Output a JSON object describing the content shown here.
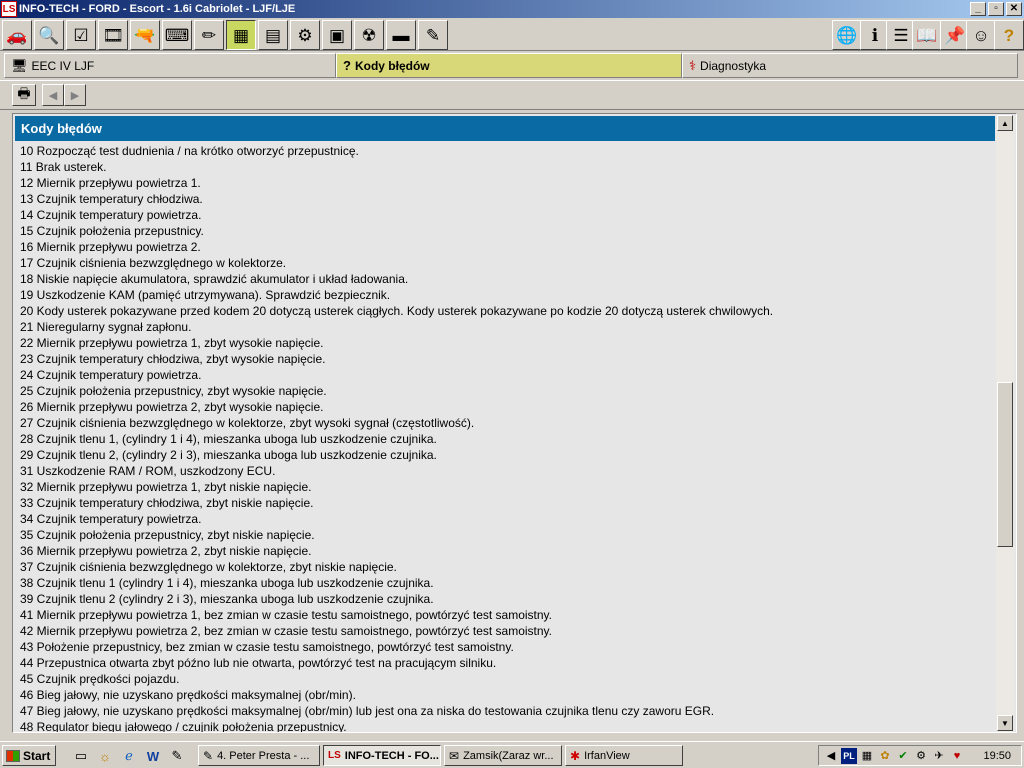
{
  "window": {
    "title": "INFO-TECH - FORD - Escort - 1.6i Cabriolet - LJF/LJE",
    "app_icon": "LS",
    "caption_buttons": {
      "minimize": "_",
      "maximize": "▫",
      "close": "✕"
    }
  },
  "toolbar": {
    "left": [
      {
        "name": "car-icon",
        "glyph": "🚗"
      },
      {
        "name": "search-info-icon",
        "glyph": "🔍"
      },
      {
        "name": "checkbox-icon",
        "glyph": "☑"
      },
      {
        "name": "film-icon",
        "glyph": "🎞"
      },
      {
        "name": "gun-icon",
        "glyph": "🔫"
      },
      {
        "name": "keyboard-icon",
        "glyph": "⌨"
      },
      {
        "name": "pencil-icon",
        "glyph": "✏"
      },
      {
        "name": "circuit-icon",
        "glyph": "▦"
      },
      {
        "name": "component-icon",
        "glyph": "▤"
      },
      {
        "name": "motor-icon",
        "glyph": "⚙"
      },
      {
        "name": "diagram-icon",
        "glyph": "▣"
      },
      {
        "name": "gauge-icon",
        "glyph": "☢"
      },
      {
        "name": "battery-icon",
        "glyph": "▬"
      },
      {
        "name": "probe-icon",
        "glyph": "✎"
      }
    ],
    "right": [
      {
        "name": "globe-icon",
        "glyph": "🌐"
      },
      {
        "name": "info-icon",
        "glyph": "ℹ"
      },
      {
        "name": "list-icon",
        "glyph": "☰"
      },
      {
        "name": "book-icon",
        "glyph": "📖"
      },
      {
        "name": "pin-icon",
        "glyph": "📌"
      },
      {
        "name": "person-icon",
        "glyph": "☺"
      },
      {
        "name": "help-icon",
        "glyph": "?"
      }
    ]
  },
  "tabs": [
    {
      "label": "EEC IV LJF",
      "icon": "🖥"
    },
    {
      "label": "Kody błędów",
      "icon": "?"
    },
    {
      "label": "Diagnostyka",
      "icon": "⚕"
    }
  ],
  "nav": {
    "print_icon": "🖶",
    "back_icon": "◀",
    "forward_icon": "▶"
  },
  "content": {
    "header": "Kody błędów",
    "rows": [
      "10 Rozpocząć test dudnienia / na krótko otworzyć przepustnicę.",
      "11 Brak usterek.",
      "12 Miernik przepływu powietrza 1.",
      "13 Czujnik temperatury chłodziwa.",
      "14 Czujnik temperatury powietrza.",
      "15 Czujnik położenia przepustnicy.",
      "16 Miernik przepływu powietrza 2.",
      "17 Czujnik ciśnienia bezwzględnego w kolektorze.",
      "18 Niskie napięcie akumulatora, sprawdzić akumulator i układ ładowania.",
      "19 Uszkodzenie KAM (pamięć utrzymywana). Sprawdzić bezpiecznik.",
      "20 Kody usterek pokazywane przed kodem 20 dotyczą usterek ciągłych. Kody usterek pokazywane po kodzie 20 dotyczą usterek chwilowych.",
      "21 Nieregularny sygnał zapłonu.",
      "22 Miernik przepływu powietrza 1, zbyt wysokie napięcie.",
      "23 Czujnik temperatury chłodziwa, zbyt wysokie napięcie.",
      "24 Czujnik temperatury powietrza.",
      "25 Czujnik położenia przepustnicy, zbyt wysokie napięcie.",
      "26 Miernik przepływu powietrza 2, zbyt wysokie napięcie.",
      "27 Czujnik ciśnienia bezwzględnego w kolektorze, zbyt wysoki sygnał (częstotliwość).",
      "28 Czujnik tlenu 1, (cylindry 1 i 4), mieszanka uboga lub uszkodzenie czujnika.",
      "29 Czujnik tlenu 2, (cylindry 2 i 3), mieszanka uboga lub uszkodzenie czujnika.",
      "31 Uszkodzenie RAM / ROM, uszkodzony ECU.",
      "32 Miernik przepływu powietrza 1, zbyt niskie napięcie.",
      "33 Czujnik temperatury chłodziwa, zbyt niskie napięcie.",
      "34 Czujnik temperatury powietrza.",
      "35 Czujnik położenia przepustnicy, zbyt niskie napięcie.",
      "36 Miernik przepływu powietrza 2, zbyt niskie napięcie.",
      "37 Czujnik ciśnienia bezwzględnego w kolektorze, zbyt niskie napięcie.",
      "38 Czujnik tlenu 1 (cylindry 1 i 4), mieszanka uboga lub uszkodzenie czujnika.",
      "39 Czujnik tlenu 2 (cylindry 2 i 3), mieszanka uboga lub uszkodzenie czujnika.",
      "41 Miernik przepływu powietrza 1, bez zmian w czasie testu samoistnego, powtórzyć test samoistny.",
      "42 Miernik przepływu powietrza 2, bez zmian w czasie testu samoistnego, powtórzyć test samoistny.",
      "43 Położenie przepustnicy, bez zmian w czasie testu samoistnego, powtórzyć test samoistny.",
      "44 Przepustnica otwarta zbyt późno lub nie otwarta, powtórzyć test na pracującym silniku.",
      "45 Czujnik prędkości pojazdu.",
      "46 Bieg jałowy, nie uzyskano prędkości maksymalnej (obr/min).",
      "47 Bieg jałowy, nie uzyskano prędkości maksymalnej (obr/min) lub jest ona za niska do testowania czujnika tlenu czy zaworu EGR.",
      "48 Regulator biegu jałowego / czujnik położenia przepustnicy."
    ]
  },
  "scrollbar": {
    "up": "▲",
    "down": "▼",
    "position": 0.55
  },
  "taskbar": {
    "start": "Start",
    "quicklaunch": [
      {
        "name": "show-desktop-icon",
        "glyph": "▭"
      },
      {
        "name": "outlook-icon",
        "glyph": "☼"
      },
      {
        "name": "ie-icon",
        "glyph": "ℯ"
      },
      {
        "name": "word-icon",
        "glyph": "W"
      },
      {
        "name": "app-icon",
        "glyph": "✎"
      }
    ],
    "tasks": [
      {
        "label": "4. Peter Presta - ...",
        "icon": "✎"
      },
      {
        "label": "INFO-TECH - FO...",
        "icon": "LS"
      },
      {
        "label": "Zamsik(Zaraz wr...",
        "icon": "✉"
      },
      {
        "label": "IrfanView",
        "icon": "✱"
      }
    ],
    "tray": {
      "icons": [
        "◀",
        "PL",
        "▦",
        "✿",
        "✔",
        "⚙",
        "✈",
        "♥"
      ],
      "clock": "19:50"
    }
  }
}
